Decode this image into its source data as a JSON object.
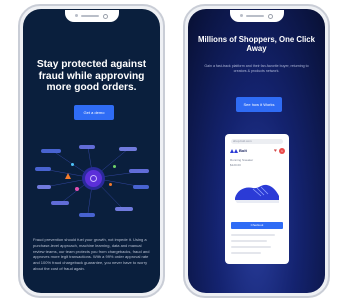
{
  "left_phone": {
    "headline": "Stay protected against fraud while approving more good orders.",
    "cta_label": "Get a demo",
    "paragraph": "Fraud prevention should fuel your growth, not impede it. Using a purchase-level approach, machine learning, data and manual review teams, our team protects you from chargebacks, fraud and approves more legit transactions. With a 99% order approval rate and 100% fraud chargeback guarantee, you never have to worry about the cost of fraud again.",
    "colors": {
      "background": "#0a1f3d",
      "button": "#2f6cf5",
      "center_node": "#5b2fd9",
      "warning": "#f47a2b"
    }
  },
  "right_phone": {
    "headline": "Millions of Shoppers, One Click Away",
    "subtitle": "Gain a fast-track platform and their fan-favorite buyer, returning to creators & products network.",
    "cta_label": "See how it Works",
    "product_screen": {
      "url": "shop.bolt.com",
      "brand": "Bolt",
      "badge_count": "1",
      "product_name": "Running Sneaker",
      "product_price": "$120.00",
      "pay_label": "Checkout"
    },
    "colors": {
      "background": "#142370",
      "button": "#2f6cf5",
      "shoe": "#2b3bd6"
    }
  }
}
